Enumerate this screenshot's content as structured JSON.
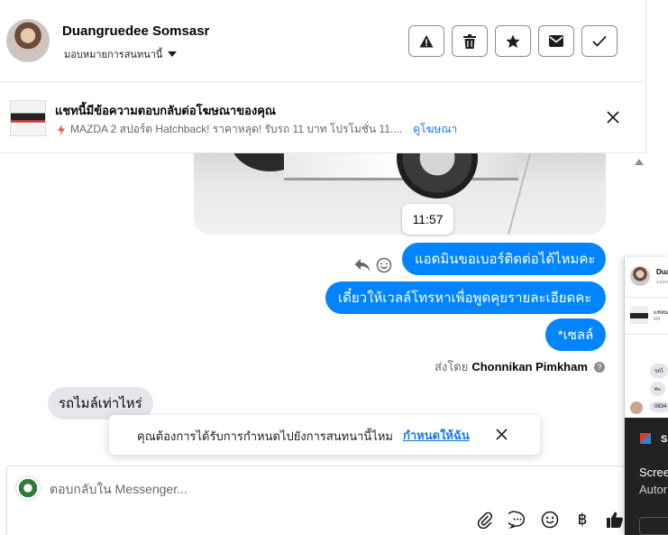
{
  "header": {
    "name": "Duangruedee Somsasr",
    "assign_label": "มอบหมายการสนทนานี้",
    "actions": [
      "report",
      "delete",
      "star",
      "mark-unread",
      "done"
    ]
  },
  "ad_banner": {
    "title": "แชทนี้มีข้อความตอบกลับต่อโฆษณาของคุณ",
    "description": "MAZDA 2 สปอร์ต Hatchback! ราคาหลุด! รับรถ 11 บาท โปรโมชั่น 11....",
    "view_ad": "ดูโฆษณา"
  },
  "messages": {
    "time": "11:57",
    "outgoing": [
      "แอดมินขอเบอร์ติดต่อได้ไหมคะ",
      "เดี๋ยวให้เวลล์โทรหาเพื่อพูดคุยรายละเอียดคะ",
      "*เซลล์"
    ],
    "sent_by_label": "ส่งโดย",
    "sent_by_name": "Chonnikan Pimkham",
    "incoming": [
      "รถไมล์เท่าไหร่"
    ]
  },
  "toast": {
    "text": "คุณต้องการได้รับการกำหนดไปยังการสนทนานี้ไหม",
    "action": "กำหนดให้ฉัน"
  },
  "composer": {
    "placeholder": "ตอบกลับใน Messenger...",
    "tools": [
      "attach-icon",
      "saved-replies-icon",
      "emoji-icon",
      "baht-icon",
      "like-icon"
    ]
  },
  "overlay": {
    "name": "Dua",
    "sub": "มอบห",
    "line1": "แชทน",
    "line2": "MA",
    "b1": "รถไ",
    "b2": "คะ",
    "b3": "0834",
    "dark_title": "Sn",
    "dark_line1": "Scree",
    "dark_line2": "Autor"
  },
  "colors": {
    "accent": "#0084ff",
    "link": "#1877f2",
    "incoming_bubble": "#e4e6eb"
  }
}
